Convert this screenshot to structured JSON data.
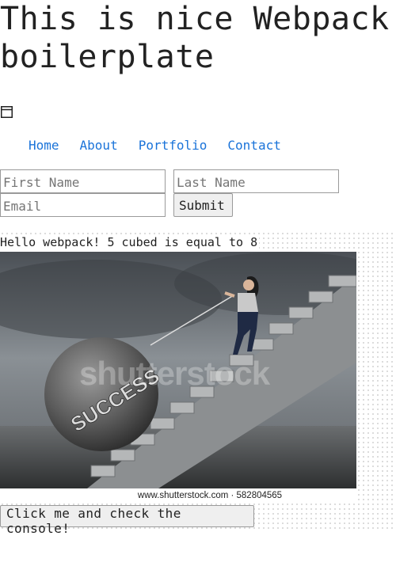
{
  "header": {
    "title": "This is nice Webpack boilerplate"
  },
  "icons": {
    "window": "browser-window-icon"
  },
  "nav": {
    "items": [
      {
        "label": "Home"
      },
      {
        "label": "About"
      },
      {
        "label": "Portfolio"
      },
      {
        "label": "Contact"
      }
    ]
  },
  "form": {
    "first_name_placeholder": "First Name",
    "last_name_placeholder": "Last Name",
    "email_placeholder": "Email",
    "submit_label": "Submit"
  },
  "content": {
    "hello_text": "Hello webpack! 5 cubed is equal to 8",
    "image_watermark": "shutterstock",
    "image_caption": "www.shutterstock.com · 582804565",
    "image_rock_text": "SUCCESS",
    "console_button_label": "Click me and check the console!"
  },
  "colors": {
    "link": "#1a73d9",
    "text": "#222222",
    "button_bg": "#efefef"
  }
}
